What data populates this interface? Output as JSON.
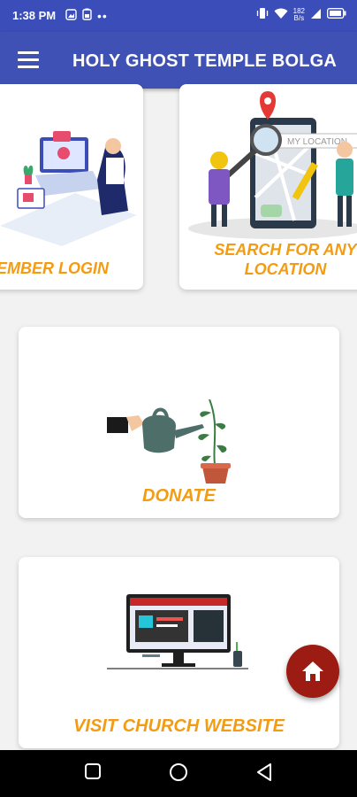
{
  "status_bar": {
    "time": "1:38 PM",
    "net_speed_top": "182",
    "net_speed_bottom": "B/s",
    "icons": [
      "gallery-icon",
      "battery-saver-icon",
      "more-dots-icon",
      "vibrate-icon",
      "wifi-icon",
      "signal-icon",
      "battery-icon"
    ]
  },
  "app_bar": {
    "title": "HOLY GHOST TEMPLE BOLGA",
    "menu_icon": "menu-icon"
  },
  "cards": {
    "member_login": {
      "label": "EMBER LOGIN"
    },
    "search_location": {
      "label_line1": "SEARCH FOR ANY",
      "label_line2": "LOCATION",
      "map_text": "MY LOCATION"
    },
    "donate": {
      "label": "DONATE"
    },
    "visit_website": {
      "label": "VISIT CHURCH WEBSITE"
    }
  },
  "fab": {
    "icon": "home-icon"
  },
  "nav_bar": {
    "icons": [
      "recent-apps-icon",
      "home-circle-icon",
      "back-icon"
    ]
  },
  "colors": {
    "primary": "#3f51b5",
    "status_bar": "#3b4db8",
    "accent_label": "#f39c12",
    "fab": "#9c1c13"
  }
}
